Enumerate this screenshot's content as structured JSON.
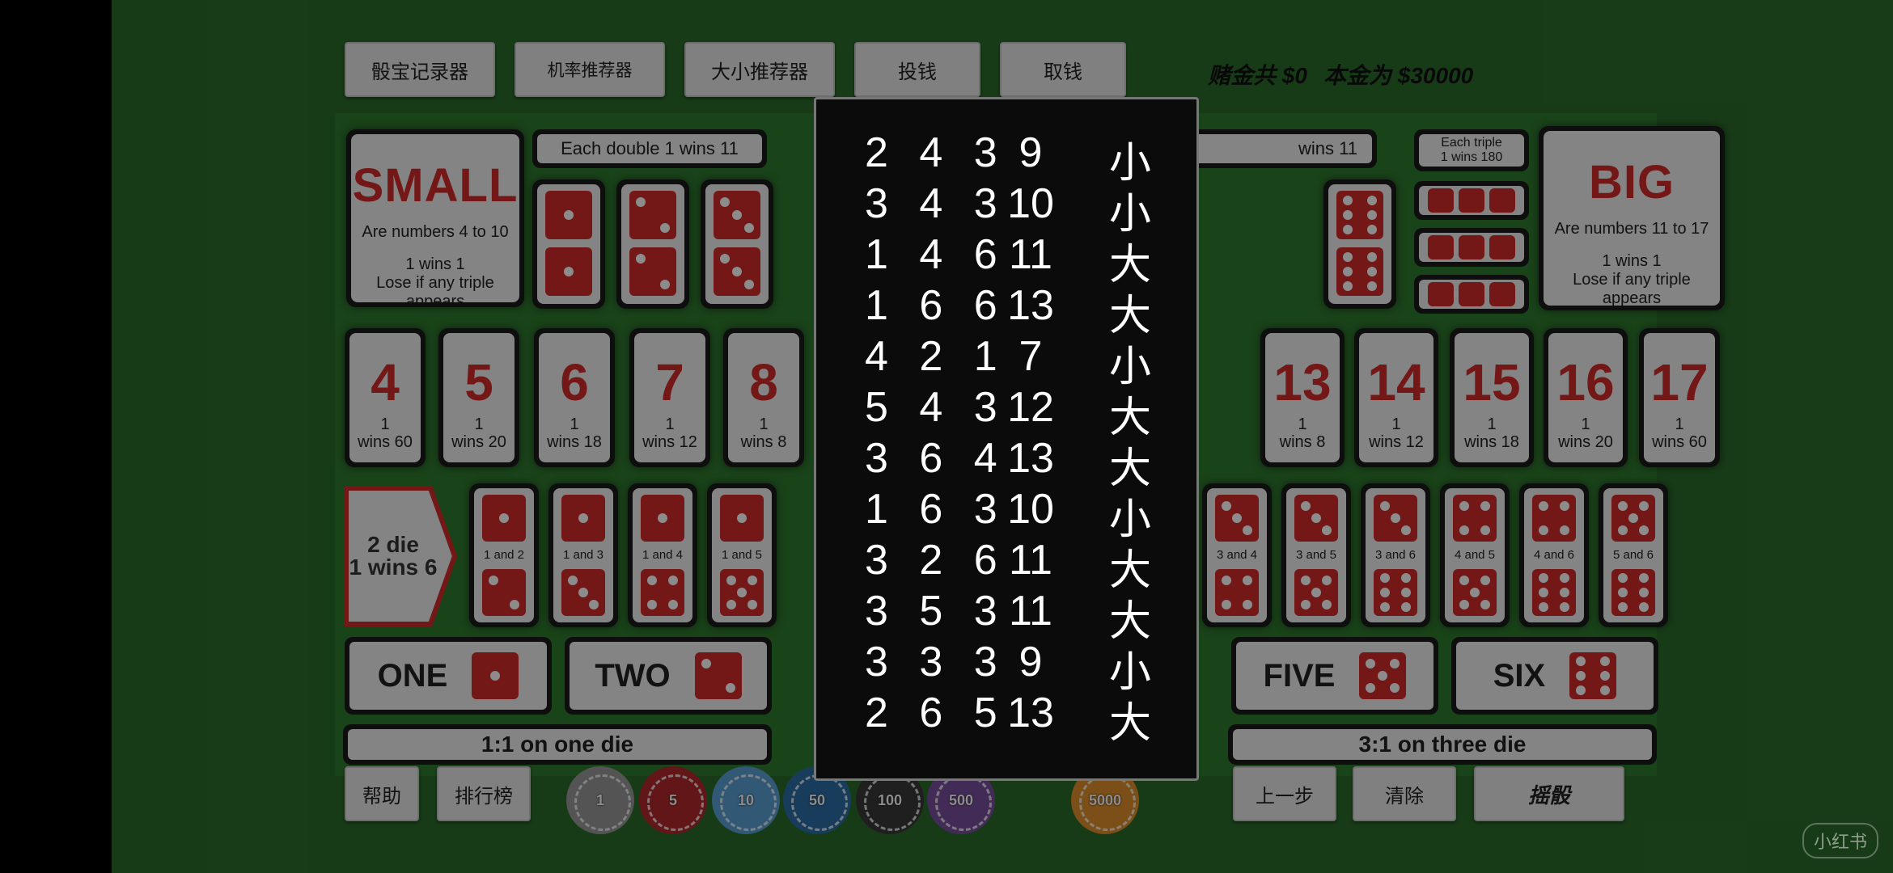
{
  "top_buttons": [
    "骰宝记录器",
    "机率推荐器",
    "大小推荐器",
    "投钱",
    "取钱"
  ],
  "bet_status": "赌金共 $0",
  "bank_status": "本金为 $30000",
  "colors": {
    "felt": "#2b6b2b",
    "die_red": "#d12b2b",
    "card": "#f1f1f1"
  },
  "small_box": {
    "title": "SMALL",
    "line1": "Are numbers 4 to 10",
    "line2": "1 wins 1",
    "line3": "Lose if any triple appears"
  },
  "big_box": {
    "title": "BIG",
    "line1": "Are numbers 11 to 17",
    "line2": "1 wins 1",
    "line3": "Lose if any triple appears"
  },
  "double_banner_left": "Each double 1 wins 11",
  "double_banner_right": "wins 11",
  "triple_banner": [
    "Each triple",
    "1 wins 180"
  ],
  "totals_left": [
    {
      "num": "4",
      "odds": [
        "1",
        "wins 60"
      ]
    },
    {
      "num": "5",
      "odds": [
        "1",
        "wins 20"
      ]
    },
    {
      "num": "6",
      "odds": [
        "1",
        "wins 18"
      ]
    },
    {
      "num": "7",
      "odds": [
        "1",
        "wins 12"
      ]
    },
    {
      "num": "8",
      "odds": [
        "1",
        "wins 8"
      ]
    }
  ],
  "totals_right": [
    {
      "num": "13",
      "odds": [
        "1",
        "wins 8"
      ]
    },
    {
      "num": "14",
      "odds": [
        "1",
        "wins 12"
      ]
    },
    {
      "num": "15",
      "odds": [
        "1",
        "wins 18"
      ]
    },
    {
      "num": "16",
      "odds": [
        "1",
        "wins 20"
      ]
    },
    {
      "num": "17",
      "odds": [
        "1",
        "wins 60"
      ]
    }
  ],
  "two_die_label": [
    "2 die",
    "1 wins 6"
  ],
  "pairs_left": [
    "1 and 2",
    "1 and 3",
    "1 and 4",
    "1 and 5"
  ],
  "pairs_right": [
    "3 and 4",
    "3 and 5",
    "3 and 6",
    "4 and 5",
    "4 and 6",
    "5 and 6"
  ],
  "singles": [
    "ONE",
    "TWO",
    "FIVE",
    "SIX"
  ],
  "single_strips": [
    "1:1 on one die",
    "3:1 on three die"
  ],
  "bottom_left_buttons": [
    "帮助",
    "排行榜"
  ],
  "bottom_right_buttons": [
    "上一步",
    "清除",
    "摇骰"
  ],
  "chips": [
    {
      "label": "1",
      "color": "#9a9a9a"
    },
    {
      "label": "5",
      "color": "#b3282d"
    },
    {
      "label": "10",
      "color": "#5aa0d6"
    },
    {
      "label": "50",
      "color": "#2d6ea8"
    },
    {
      "label": "100",
      "color": "#3a3a3a"
    },
    {
      "label": "500",
      "color": "#7b4fa0"
    },
    {
      "label": "5000",
      "color": "#e0902a"
    }
  ],
  "history": [
    {
      "dice": "2 4 3",
      "sum": "9",
      "result": "小"
    },
    {
      "dice": "3 4 3",
      "sum": "10",
      "result": "小"
    },
    {
      "dice": "1 4 6",
      "sum": "11",
      "result": "大"
    },
    {
      "dice": "1 6 6",
      "sum": "13",
      "result": "大"
    },
    {
      "dice": "4 2 1",
      "sum": "7",
      "result": "小"
    },
    {
      "dice": "5 4 3",
      "sum": "12",
      "result": "大"
    },
    {
      "dice": "3 6 4",
      "sum": "13",
      "result": "大"
    },
    {
      "dice": "1 6 3",
      "sum": "10",
      "result": "小"
    },
    {
      "dice": "3 2 6",
      "sum": "11",
      "result": "大"
    },
    {
      "dice": "3 5 3",
      "sum": "11",
      "result": "大"
    },
    {
      "dice": "3 3 3",
      "sum": "9",
      "result": "小"
    },
    {
      "dice": "2 6 5",
      "sum": "13",
      "result": "大"
    }
  ],
  "watermark": "小红书"
}
